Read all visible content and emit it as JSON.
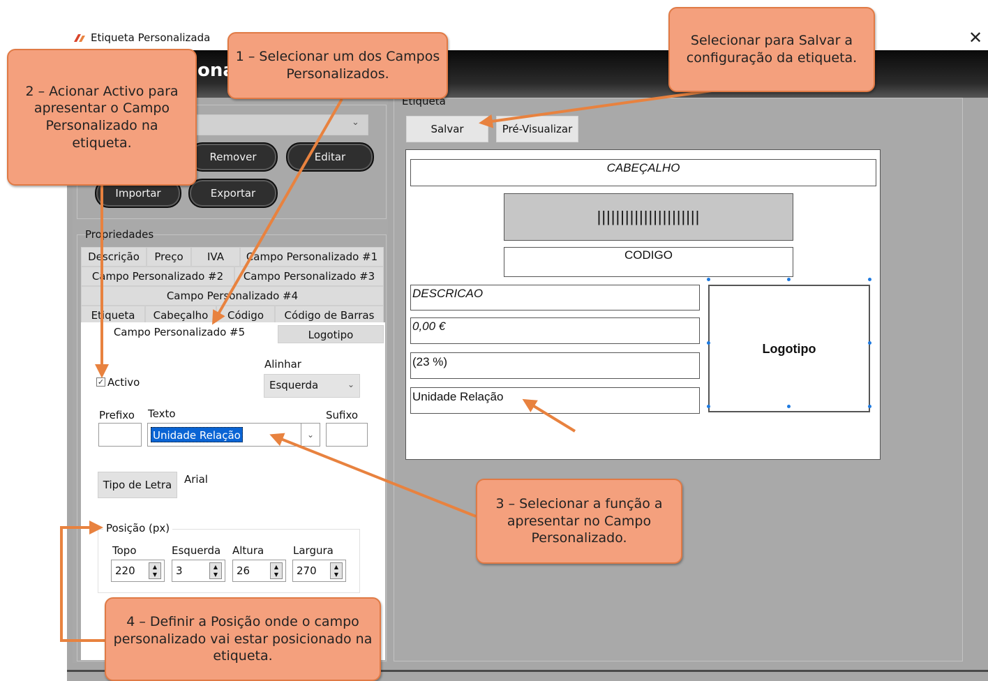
{
  "window": {
    "title": "Etiqueta Personalizada",
    "app_icon": "app-logo-icon",
    "header_partial": "ona",
    "close_glyph": "✕"
  },
  "toolbar_left": {
    "remover": "Remover",
    "editar": "Editar",
    "importar": "Importar",
    "exportar": "Exportar",
    "propriedades": "Propriedades"
  },
  "tabs": {
    "descricao": "Descrição",
    "preco": "Preço",
    "iva": "IVA",
    "cp1": "Campo Personalizado #1",
    "cp2": "Campo Personalizado #2",
    "cp3": "Campo Personalizado #3",
    "cp4": "Campo Personalizado #4",
    "etiqueta": "Etiqueta",
    "cabecalho": "Cabeçalho",
    "codigo": "Código",
    "codigo_barras": "Código de Barras",
    "cp5": "Campo Personalizado #5",
    "logotipo": "Logotipo"
  },
  "form": {
    "alinhar_label": "Alinhar",
    "alinhar_value": "Esquerda",
    "activo_label": "Activo",
    "activo_checked": true,
    "prefixo_label": "Prefixo",
    "texto_label": "Texto",
    "sufixo_label": "Sufixo",
    "texto_value": "Unidade Relação",
    "tipo_letra_button": "Tipo de Letra",
    "font_name": "Arial",
    "posicao_label": "Posição (px)",
    "topo_label": "Topo",
    "esquerda_label": "Esquerda",
    "altura_label": "Altura",
    "largura_label": "Largura",
    "topo": "220",
    "esquerda": "3",
    "altura": "26",
    "largura": "270"
  },
  "preview": {
    "group_label": "Etiqueta",
    "salvar": "Salvar",
    "previsualizar": "Pré-Visualizar",
    "cabecalho": "CABEÇALHO",
    "barcode": "||||||||||||||||||||||",
    "codigo": "CODIGO",
    "descricao": "DESCRICAO",
    "preco": "0,00 €",
    "iva": "(23 %)",
    "unidade": "Unidade Relação",
    "logotipo": "Logotipo"
  },
  "callouts": {
    "c1": "1 – Selecionar um dos Campos Personalizados.",
    "c2": "2 – Acionar Activo para apresentar o Campo Personalizado na etiqueta.",
    "c_salvar": "Selecionar para Salvar a configuração da etiqueta.",
    "c3": "3 – Selecionar a função a apresentar no Campo Personalizado.",
    "c4": "4 – Definir a Posição onde o campo personalizado vai estar posicionado na etiqueta."
  },
  "colors": {
    "callout_fill": "#f4a07d",
    "callout_border": "#e07a45",
    "arrow": "#e8823f",
    "selection": "#0a64d4"
  }
}
